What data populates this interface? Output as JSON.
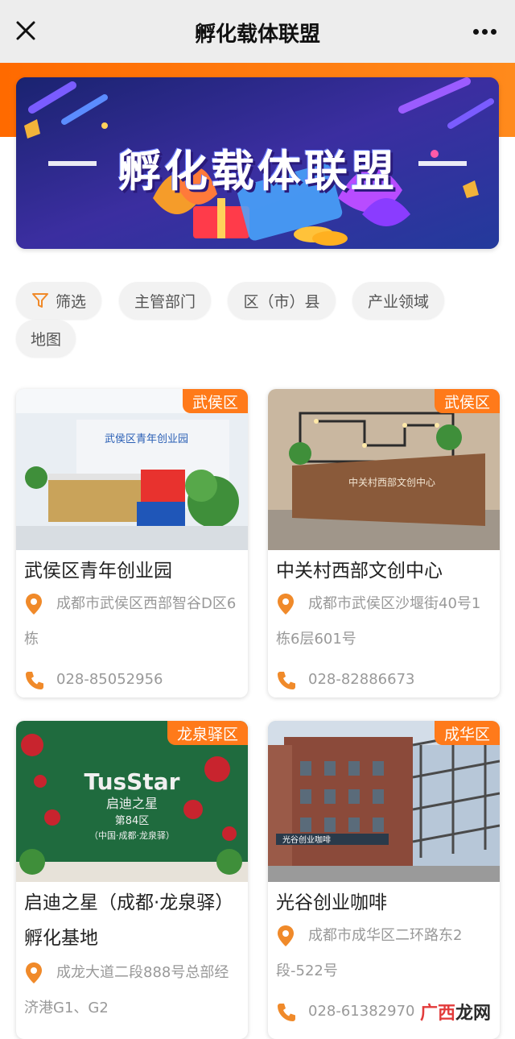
{
  "header": {
    "title": "孵化载体联盟"
  },
  "banner": {
    "title": "孵化载体联盟"
  },
  "filters": [
    {
      "label": "筛选"
    },
    {
      "label": "主管部门"
    },
    {
      "label": "区（市）县"
    },
    {
      "label": "产业领域"
    },
    {
      "label": "地图"
    }
  ],
  "cards": [
    {
      "tag": "武侯区",
      "name": "武侯区青年创业园",
      "address": "成都市武侯区西部智谷D区6栋",
      "phone": "028-85052956",
      "photo_sign": "武侯区青年创业园"
    },
    {
      "tag": "武侯区",
      "name": "中关村西部文创中心",
      "address": "成都市武侯区沙堰街40号1栋6层601号",
      "phone": "028-82886673",
      "photo_sign": "中关村西部文创中心"
    },
    {
      "tag": "龙泉驿区",
      "name": "启迪之星（成都·龙泉驿）孵化基地",
      "address": "成龙大道二段888号总部经济港G1、G2",
      "phone": "",
      "photo_sign": "TusStar",
      "photo_sub1": "启迪之星",
      "photo_sub2": "第84区",
      "photo_sub3": "（中国·成都·龙泉驿）"
    },
    {
      "tag": "成华区",
      "name": "光谷创业咖啡",
      "address": "成都市成华区二环路东2段-522号",
      "phone": "028-61382970",
      "photo_sign": "光谷创业咖啡"
    }
  ],
  "watermark": {
    "brand": "广西",
    "suffix": "龙网"
  },
  "colors": {
    "accent": "#ff7a1a",
    "icon": "#f08a2a"
  }
}
